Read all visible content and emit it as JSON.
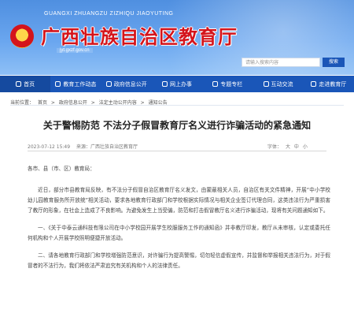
{
  "header": {
    "pinyin": "GUANGXI ZHUANGZU ZIZHIQU JIAOYUTING",
    "site_title": "广西壮族自治区教育厅",
    "site_url": "jyt.gxzf.gov.cn",
    "search_placeholder": "请输入搜索内容",
    "search_button": "搜索"
  },
  "nav": {
    "items": [
      {
        "label": "首页",
        "icon": "home-icon"
      },
      {
        "label": "教育工作动态",
        "icon": "news-icon"
      },
      {
        "label": "政府信息公开",
        "icon": "document-icon"
      },
      {
        "label": "网上办事",
        "icon": "service-icon"
      },
      {
        "label": "专题专栏",
        "icon": "column-icon"
      },
      {
        "label": "互动交流",
        "icon": "chat-icon"
      },
      {
        "label": "走进教育厅",
        "icon": "building-icon"
      }
    ]
  },
  "breadcrumb": {
    "prefix": "当前位置：",
    "items": [
      "首页",
      "政府信息公开",
      "法定主动公开内容",
      "通知公告"
    ],
    "separator": ">"
  },
  "article": {
    "title": "关于警惕防范 不法分子假冒教育厅名义进行诈骗活动的紧急通知",
    "date": "2023-07-12 15:49",
    "source": "来源：广西壮族自治区教育厅",
    "font_label": "字体：",
    "font_large": "大",
    "font_medium": "中",
    "font_small": "小",
    "salutation": "各市、县（市、区）教育局：",
    "paragraphs": [
      "近日，部分市县教育局反映，有不法分子假冒自治区教育厅名义发文，由蒙蔽相关人员，自治区有关文件精神，开展“中小学校幼儿园教育服务所开放统”相关活动，要求各地教育行政部门和学校根据实际情况与相关企业签订代理合同，这类违法行为严重损害了教厅的形象，在社会上造成了不良影响。为避免发生上当受骗，防范和打击假冒教厅名义进行诈骗活动，现将有关问题通知如下。",
      "一、《关于中泰云通科技有限公司在中小学校园开展学生校服服务工作的通知函》并非教厅印发，教厅从未审核，认定或委托任何机构和个人开展学校照明便捷开放活动。",
      "二、请各地教育行政部门和学校增强防范意识，对许骗行为提高警惕，切勿轻信虚假宣传，并监督和举报相关违法行为，对于假冒者的不法行为，我们将依法严肃追究有关机构和个人的法律责任。"
    ]
  }
}
